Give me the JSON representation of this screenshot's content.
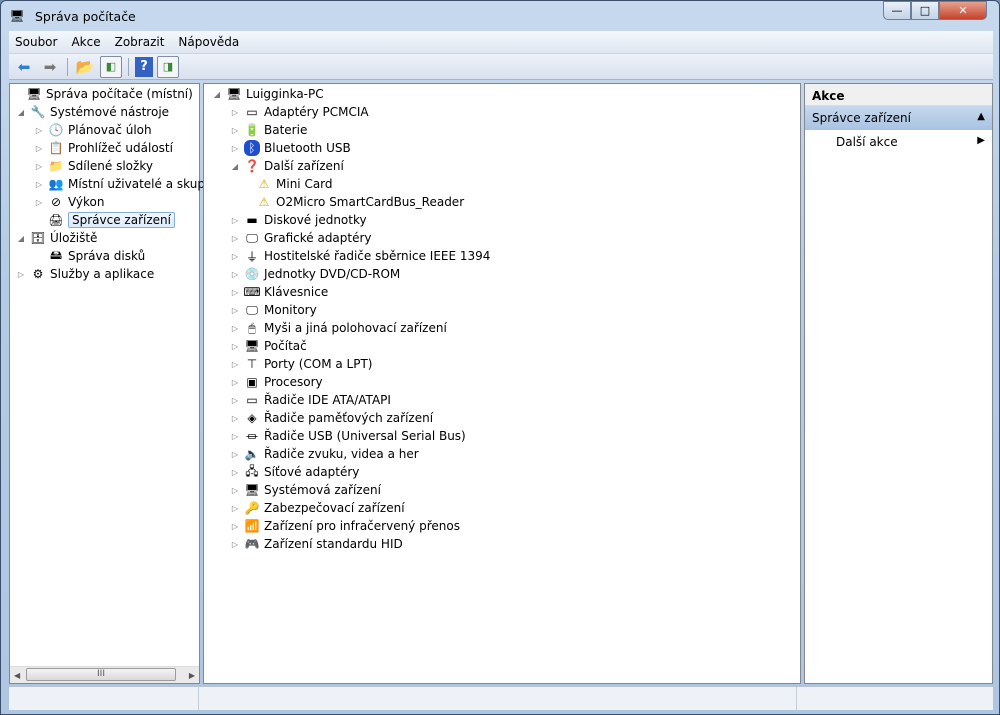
{
  "window": {
    "title": "Správa počítače",
    "minimize": "—",
    "maximize": "□",
    "close": "✕"
  },
  "menu": [
    "Soubor",
    "Akce",
    "Zobrazit",
    "Nápověda"
  ],
  "toolbar": [
    "back",
    "forward",
    "up",
    "show-hide-console-tree",
    "help",
    "show-hide-action-pane"
  ],
  "left_tree": [
    {
      "label": "Správa počítače (místní)",
      "level": 0,
      "exp": "",
      "icon": "computer-management-icon",
      "glyph": "🖥"
    },
    {
      "label": "Systémové nástroje",
      "level": 1,
      "exp": "◢",
      "icon": "tools-icon",
      "glyph": "🔧"
    },
    {
      "label": "Plánovač úloh",
      "level": 2,
      "exp": "▷",
      "icon": "clock-icon",
      "glyph": "🕓"
    },
    {
      "label": "Prohlížeč událostí",
      "level": 2,
      "exp": "▷",
      "icon": "event-viewer-icon",
      "glyph": "📋"
    },
    {
      "label": "Sdílené složky",
      "level": 2,
      "exp": "▷",
      "icon": "shared-folders-icon",
      "glyph": "📁"
    },
    {
      "label": "Místní uživatelé a skupiny",
      "level": 2,
      "exp": "▷",
      "icon": "users-icon",
      "glyph": "👥"
    },
    {
      "label": "Výkon",
      "level": 2,
      "exp": "▷",
      "icon": "performance-icon",
      "glyph": "⊘"
    },
    {
      "label": "Správce zařízení",
      "level": 2,
      "exp": "",
      "icon": "device-manager-icon",
      "glyph": "🖨",
      "selected": true
    },
    {
      "label": "Úložiště",
      "level": 1,
      "exp": "◢",
      "icon": "storage-icon",
      "glyph": "🗄"
    },
    {
      "label": "Správa disků",
      "level": 2,
      "exp": "",
      "icon": "disk-management-icon",
      "glyph": "🖴"
    },
    {
      "label": "Služby a aplikace",
      "level": 1,
      "exp": "▷",
      "icon": "services-icon",
      "glyph": "⚙"
    }
  ],
  "left_scroll": {
    "thumb": "III",
    "left": "◀",
    "right": "▶"
  },
  "device_tree": {
    "root": "Luigginka-PC",
    "items": [
      {
        "label": "Adaptéry PCMCIA",
        "exp": "▷",
        "icon": "pcmcia-icon",
        "glyph": "▭"
      },
      {
        "label": "Baterie",
        "exp": "▷",
        "icon": "battery-icon",
        "glyph": "🔋"
      },
      {
        "label": "Bluetooth USB",
        "exp": "▷",
        "icon": "bluetooth-icon",
        "glyph": "ᛒ"
      },
      {
        "label": "Další zařízení",
        "exp": "◢",
        "icon": "other-devices-icon",
        "glyph": "❓"
      },
      {
        "label": "Mini Card",
        "exp": "",
        "icon": "warning-device-icon",
        "glyph": "⚠",
        "child": true
      },
      {
        "label": "O2Micro SmartCardBus_Reader",
        "exp": "",
        "icon": "warning-device-icon",
        "glyph": "⚠",
        "child": true
      },
      {
        "label": "Diskové jednotky",
        "exp": "▷",
        "icon": "disk-drive-icon",
        "glyph": "▬"
      },
      {
        "label": "Grafické adaptéry",
        "exp": "▷",
        "icon": "display-adapter-icon",
        "glyph": "🖵"
      },
      {
        "label": "Hostitelské řadiče sběrnice IEEE 1394",
        "exp": "▷",
        "icon": "ieee1394-icon",
        "glyph": "⏚"
      },
      {
        "label": "Jednotky DVD/CD-ROM",
        "exp": "▷",
        "icon": "dvd-icon",
        "glyph": "💿"
      },
      {
        "label": "Klávesnice",
        "exp": "▷",
        "icon": "keyboard-icon",
        "glyph": "⌨"
      },
      {
        "label": "Monitory",
        "exp": "▷",
        "icon": "monitor-icon",
        "glyph": "🖵"
      },
      {
        "label": "Myši a jiná polohovací zařízení",
        "exp": "▷",
        "icon": "mouse-icon",
        "glyph": "🖱"
      },
      {
        "label": "Počítač",
        "exp": "▷",
        "icon": "computer-icon",
        "glyph": "🖥"
      },
      {
        "label": "Porty (COM a LPT)",
        "exp": "▷",
        "icon": "port-icon",
        "glyph": "⊤"
      },
      {
        "label": "Procesory",
        "exp": "▷",
        "icon": "processor-icon",
        "glyph": "▣"
      },
      {
        "label": "Řadiče IDE ATA/ATAPI",
        "exp": "▷",
        "icon": "ide-icon",
        "glyph": "▭"
      },
      {
        "label": "Řadiče paměťových zařízení",
        "exp": "▷",
        "icon": "storage-controller-icon",
        "glyph": "◈"
      },
      {
        "label": "Řadiče USB (Universal Serial Bus)",
        "exp": "▷",
        "icon": "usb-icon",
        "glyph": "⏛"
      },
      {
        "label": "Řadiče zvuku, videa a her",
        "exp": "▷",
        "icon": "sound-icon",
        "glyph": "🔈"
      },
      {
        "label": "Síťové adaptéry",
        "exp": "▷",
        "icon": "network-icon",
        "glyph": "🖧"
      },
      {
        "label": "Systémová zařízení",
        "exp": "▷",
        "icon": "system-device-icon",
        "glyph": "🖥"
      },
      {
        "label": "Zabezpečovací zařízení",
        "exp": "▷",
        "icon": "security-device-icon",
        "glyph": "🔑"
      },
      {
        "label": "Zařízení pro infračervený přenos",
        "exp": "▷",
        "icon": "infrared-icon",
        "glyph": "📶"
      },
      {
        "label": "Zařízení standardu HID",
        "exp": "▷",
        "icon": "hid-icon",
        "glyph": "🎮"
      }
    ]
  },
  "actions": {
    "header": "Akce",
    "section": "Správce zařízení",
    "section_arrow": "▲",
    "item": "Další akce",
    "item_arrow": "▶"
  }
}
